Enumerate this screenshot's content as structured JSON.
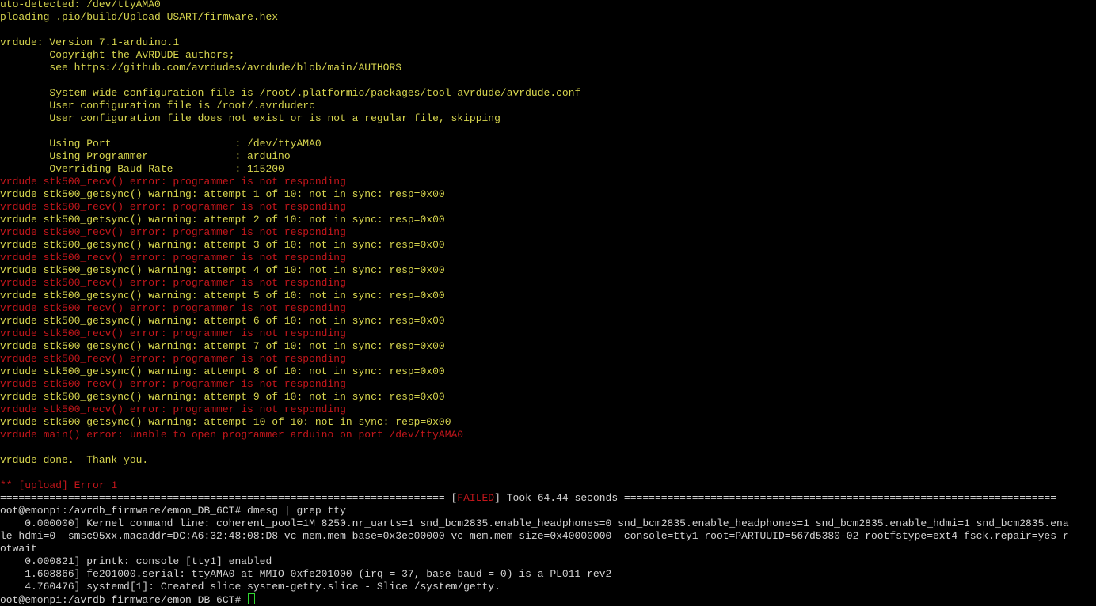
{
  "colors": {
    "background": "#000000",
    "yellow": "#d7d54e",
    "red": "#c4161b",
    "white": "#d3d3d3",
    "cursor": "#2fd92f"
  },
  "lines": [
    [
      {
        "c": "y",
        "t": "uto-detected: /dev/ttyAMA0"
      }
    ],
    [
      {
        "c": "y",
        "t": "ploading .pio/build/Upload_USART/firmware.hex"
      }
    ],
    [
      {
        "c": "y",
        "t": ""
      }
    ],
    [
      {
        "c": "y",
        "t": "vrdude: Version 7.1-arduino.1"
      }
    ],
    [
      {
        "c": "y",
        "t": "        Copyright the AVRDUDE authors;"
      }
    ],
    [
      {
        "c": "y",
        "t": "        see https://github.com/avrdudes/avrdude/blob/main/AUTHORS"
      }
    ],
    [
      {
        "c": "y",
        "t": ""
      }
    ],
    [
      {
        "c": "y",
        "t": "        System wide configuration file is /root/.platformio/packages/tool-avrdude/avrdude.conf"
      }
    ],
    [
      {
        "c": "y",
        "t": "        User configuration file is /root/.avrduderc"
      }
    ],
    [
      {
        "c": "y",
        "t": "        User configuration file does not exist or is not a regular file, skipping"
      }
    ],
    [
      {
        "c": "y",
        "t": ""
      }
    ],
    [
      {
        "c": "y",
        "t": "        Using Port                    : /dev/ttyAMA0"
      }
    ],
    [
      {
        "c": "y",
        "t": "        Using Programmer              : arduino"
      }
    ],
    [
      {
        "c": "y",
        "t": "        Overriding Baud Rate          : 115200"
      }
    ],
    [
      {
        "c": "r",
        "t": "vrdude stk500_recv() error: programmer is not responding"
      }
    ],
    [
      {
        "c": "y",
        "t": "vrdude stk500_getsync() warning: attempt 1 of 10: not in sync: resp=0x00"
      }
    ],
    [
      {
        "c": "r",
        "t": "vrdude stk500_recv() error: programmer is not responding"
      }
    ],
    [
      {
        "c": "y",
        "t": "vrdude stk500_getsync() warning: attempt 2 of 10: not in sync: resp=0x00"
      }
    ],
    [
      {
        "c": "r",
        "t": "vrdude stk500_recv() error: programmer is not responding"
      }
    ],
    [
      {
        "c": "y",
        "t": "vrdude stk500_getsync() warning: attempt 3 of 10: not in sync: resp=0x00"
      }
    ],
    [
      {
        "c": "r",
        "t": "vrdude stk500_recv() error: programmer is not responding"
      }
    ],
    [
      {
        "c": "y",
        "t": "vrdude stk500_getsync() warning: attempt 4 of 10: not in sync: resp=0x00"
      }
    ],
    [
      {
        "c": "r",
        "t": "vrdude stk500_recv() error: programmer is not responding"
      }
    ],
    [
      {
        "c": "y",
        "t": "vrdude stk500_getsync() warning: attempt 5 of 10: not in sync: resp=0x00"
      }
    ],
    [
      {
        "c": "r",
        "t": "vrdude stk500_recv() error: programmer is not responding"
      }
    ],
    [
      {
        "c": "y",
        "t": "vrdude stk500_getsync() warning: attempt 6 of 10: not in sync: resp=0x00"
      }
    ],
    [
      {
        "c": "r",
        "t": "vrdude stk500_recv() error: programmer is not responding"
      }
    ],
    [
      {
        "c": "y",
        "t": "vrdude stk500_getsync() warning: attempt 7 of 10: not in sync: resp=0x00"
      }
    ],
    [
      {
        "c": "r",
        "t": "vrdude stk500_recv() error: programmer is not responding"
      }
    ],
    [
      {
        "c": "y",
        "t": "vrdude stk500_getsync() warning: attempt 8 of 10: not in sync: resp=0x00"
      }
    ],
    [
      {
        "c": "r",
        "t": "vrdude stk500_recv() error: programmer is not responding"
      }
    ],
    [
      {
        "c": "y",
        "t": "vrdude stk500_getsync() warning: attempt 9 of 10: not in sync: resp=0x00"
      }
    ],
    [
      {
        "c": "r",
        "t": "vrdude stk500_recv() error: programmer is not responding"
      }
    ],
    [
      {
        "c": "y",
        "t": "vrdude stk500_getsync() warning: attempt 10 of 10: not in sync: resp=0x00"
      }
    ],
    [
      {
        "c": "r",
        "t": "vrdude main() error: unable to open programmer arduino on port /dev/ttyAMA0"
      }
    ],
    [
      {
        "c": "y",
        "t": ""
      }
    ],
    [
      {
        "c": "y",
        "t": "vrdude done.  Thank you."
      }
    ],
    [
      {
        "c": "y",
        "t": ""
      }
    ],
    [
      {
        "c": "r",
        "t": "** [upload] Error 1"
      }
    ],
    [
      {
        "c": "w",
        "t": "======================================================================== ["
      },
      {
        "c": "r",
        "t": "FAILED"
      },
      {
        "c": "w",
        "t": "] Took 64.44 seconds ======================================================================"
      }
    ],
    [
      {
        "c": "w",
        "t": "oot@emonpi:/avrdb_firmware/emon_DB_6CT# dmesg | grep tty"
      }
    ],
    [
      {
        "c": "w",
        "t": "    0.000000] Kernel command line: coherent_pool=1M 8250.nr_uarts=1 snd_bcm2835.enable_headphones=0 snd_bcm2835.enable_headphones=1 snd_bcm2835.enable_hdmi=1 snd_bcm2835.ena"
      }
    ],
    [
      {
        "c": "w",
        "t": "le_hdmi=0  smsc95xx.macaddr=DC:A6:32:48:08:D8 vc_mem.mem_base=0x3ec00000 vc_mem.mem_size=0x40000000  console=tty1 root=PARTUUID=567d5380-02 rootfstype=ext4 fsck.repair=yes r"
      }
    ],
    [
      {
        "c": "w",
        "t": "otwait"
      }
    ],
    [
      {
        "c": "w",
        "t": "    0.000821] printk: console [tty1] enabled"
      }
    ],
    [
      {
        "c": "w",
        "t": "    1.608866] fe201000.serial: ttyAMA0 at MMIO 0xfe201000 (irq = 37, base_baud = 0) is a PL011 rev2"
      }
    ],
    [
      {
        "c": "w",
        "t": "    4.760476] systemd[1]: Created slice system-getty.slice - Slice /system/getty."
      }
    ],
    [
      {
        "c": "w",
        "t": "oot@emonpi:/avrdb_firmware/emon_DB_6CT# "
      }
    ]
  ]
}
